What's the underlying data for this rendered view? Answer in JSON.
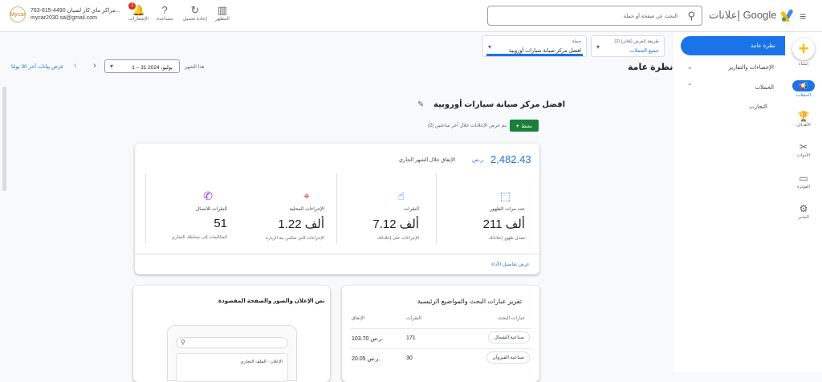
{
  "account": {
    "logo_text": "Mycar",
    "line1": "763-615-4490 مراكز ماي كار لصيان...",
    "line2": "mycar2030.sa@gmail.com"
  },
  "toolbar": {
    "notifications": "الإشعارات",
    "notifications_badge": "1",
    "help": "مساعدة",
    "refresh": "إعادة تحميل",
    "appearance": "المظهر"
  },
  "search": {
    "placeholder": "البحث عن صفحة أو حملة"
  },
  "brand": {
    "name": "إعلانات Google",
    "colors": {
      "blue": "#4285f4",
      "yellow": "#fbbc04",
      "green": "#34a853"
    }
  },
  "rail": {
    "create": "إنشاء",
    "items": [
      {
        "icon": "campaigns-icon",
        "label": "الحملات"
      },
      {
        "icon": "goals-icon",
        "label": "الأهداف"
      },
      {
        "icon": "tools-icon",
        "label": "الأدوات"
      },
      {
        "icon": "billing-icon",
        "label": "الفوترة"
      },
      {
        "icon": "admin-icon",
        "label": "المدير"
      }
    ]
  },
  "nav": {
    "overview": "نظرة عامة",
    "insights": "الإحصاءات والتقارير",
    "campaigns": "الحملات",
    "experiments": "التجارب"
  },
  "pickers": {
    "view": {
      "label": "طريقة العرض (فلاتر) (2)",
      "value": "جميع الحملات"
    },
    "campaign": {
      "label": "حملة",
      "value": "افضل مركز صيانة سيارات أوروبية"
    }
  },
  "daterange": {
    "prev_label": "عرض بيانات آخر 30 يومًا",
    "period": "هذا الشهر",
    "value": "1 – 31 يوليو، 2024"
  },
  "page": {
    "title": "نظرة عامة",
    "campaign_name": "افضل مركز صيانة سيارات أوروبية",
    "status": "نشط",
    "note": "تم عرض الإعلانات خلال آخر ساعتين (2)."
  },
  "summary": {
    "amount": "2,482.43",
    "currency": "ر.س.",
    "amount_label": "الإنفاق خلال الشهر الجاري",
    "metrics": [
      {
        "icon": "impressions-icon",
        "name": "عدد مرات الظهور",
        "value": "211 ألف",
        "sub": "معدل ظهور إعلاناتك"
      },
      {
        "icon": "clicks-icon",
        "name": "النقرات",
        "value": "7.12 ألف",
        "sub": "الإجراءات على إعلاناتك"
      },
      {
        "icon": "local-actions-icon",
        "name": "الإجراءات المحلية",
        "value": "1.22 ألف",
        "sub": "الإجراءات التي تعكس نية الزيارة"
      },
      {
        "icon": "calls-icon",
        "name": "النقرات للاتصال",
        "value": "51",
        "sub": "المكالمات إلى نشاطك التجاري"
      }
    ],
    "details_link": "عرض تفاصيل الأداء"
  },
  "search_terms": {
    "title": "تقرير عبارات البحث والمواضيع الرئيسية",
    "headers": {
      "term": "عبارات البحث",
      "clicks": "النقرات",
      "cost": "الإنفاق"
    },
    "rows": [
      {
        "term": "صناعية الشمال",
        "clicks": "171",
        "cost": "103.70 ر.س."
      },
      {
        "term": "صناعية القيروان",
        "clicks": "30",
        "cost": "20.05 ر.س."
      }
    ]
  },
  "ad_preview": {
    "title": "نص الإعلان والصور والصفحة المقصودة",
    "label": "الإعلان · الملف التجاري"
  }
}
